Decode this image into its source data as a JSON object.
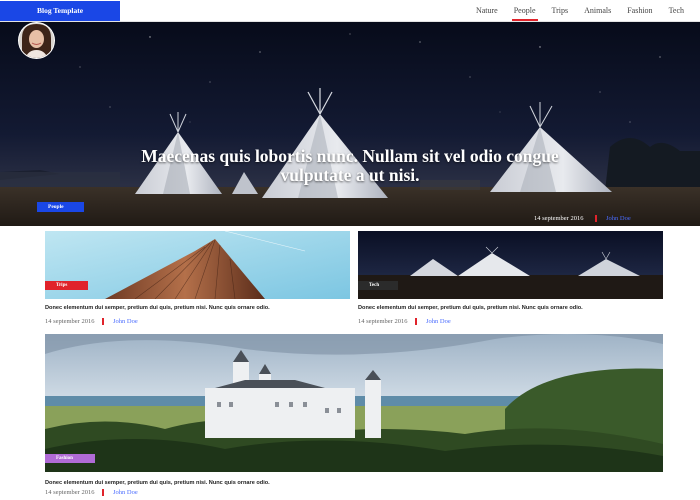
{
  "brand": "Blog Template",
  "nav": [
    {
      "label": "Nature",
      "active": false
    },
    {
      "label": "People",
      "active": true
    },
    {
      "label": "Trips",
      "active": false
    },
    {
      "label": "Animals",
      "active": false
    },
    {
      "label": "Fashion",
      "active": false
    },
    {
      "label": "Tech",
      "active": false
    }
  ],
  "hero": {
    "title": "Maecenas quis lobortis nunc. Nullam sit vel odio congue vulputate a ut nisi.",
    "tag": "People",
    "date": "14 september 2016",
    "author": "John Doe"
  },
  "cards": [
    {
      "tag": "Trips",
      "tag_color": "#e0232b",
      "excerpt": "Donec elementum dui semper, pretium dui quis, pretium nisi. Nunc quis ornare odio.",
      "date": "14 september 2016",
      "author": "John Doe"
    },
    {
      "tag": "Tech",
      "tag_color": "#2b2b2b",
      "excerpt": "Donec elementum dui semper, pretium dui quis, pretium nisi. Nunc quis ornare odio.",
      "date": "14 september 2016",
      "author": "John Doe"
    },
    {
      "tag": "Fashion",
      "tag_color": "#b06bd6",
      "excerpt": "Donec elementum dui semper, pretium dui quis, pretium nisi. Nunc quis ornare odio.",
      "date": "14 september 2016",
      "author": "John Doe"
    }
  ],
  "colors": {
    "brand": "#1a47e6",
    "accent_red": "#e0232b",
    "link": "#4a6cff"
  }
}
